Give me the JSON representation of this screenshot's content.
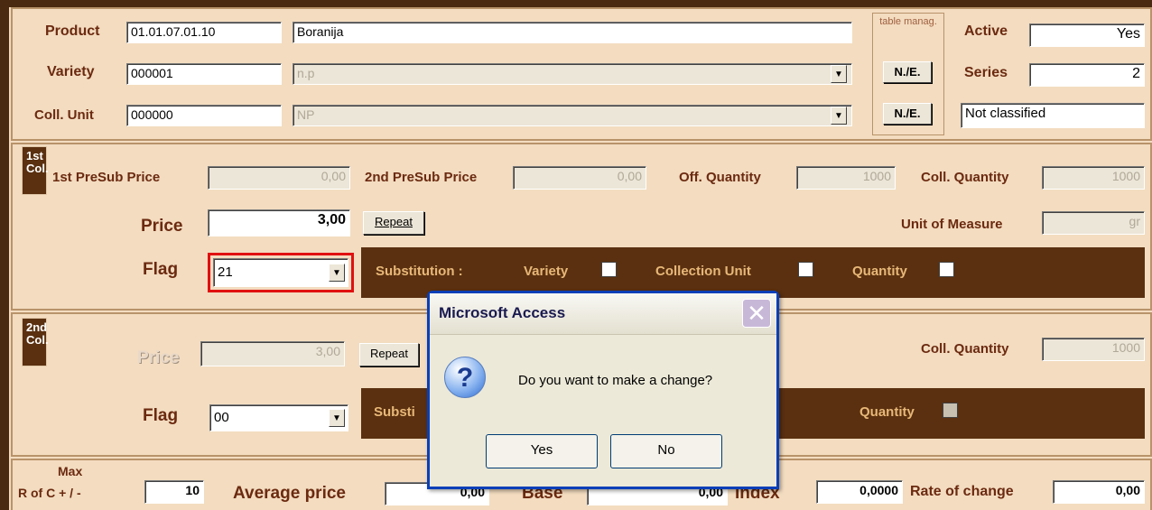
{
  "header": {
    "product_label": "Product",
    "product_code": "01.01.07.01.10",
    "product_name": "Boranija",
    "variety_label": "Variety",
    "variety_code": "000001",
    "variety_name": "n.p",
    "coll_unit_label": "Coll. Unit",
    "coll_unit_code": "000000",
    "coll_unit_name": "NP",
    "table_manag_label": "table manag.",
    "ne_button": "N./E.",
    "active_label": "Active",
    "active_value": "Yes",
    "series_label": "Series",
    "series_value": "2",
    "classification": "Not classified"
  },
  "col1": {
    "badge": "1st Col.",
    "presub1_label": "1st PreSub Price",
    "presub1_value": "0,00",
    "presub2_label": "2nd PreSub Price",
    "presub2_value": "0,00",
    "off_qty_label": "Off. Quantity",
    "off_qty_value": "1000",
    "coll_qty_label": "Coll. Quantity",
    "coll_qty_value": "1000",
    "price_label": "Price",
    "price_value": "3,00",
    "repeat_label": "Repeat",
    "uom_label": "Unit of Measure",
    "uom_value": "gr",
    "flag_label": "Flag",
    "flag_value": "21",
    "substitution_label": "Substitution :",
    "variety_chk_label": "Variety",
    "coll_unit_chk_label": "Collection Unit",
    "quantity_chk_label": "Quantity"
  },
  "col2": {
    "badge": "2nd Col.",
    "price_label": "Price",
    "price_value": "3,00",
    "repeat_label": "Repeat",
    "coll_qty_label": "Coll. Quantity",
    "coll_qty_value": "1000",
    "flag_label": "Flag",
    "flag_value": "00",
    "substitution_partial": "Substi",
    "quantity_chk_label": "Quantity"
  },
  "bottom": {
    "max_label": "Max",
    "rofc_label": "R of C + / -",
    "max_value": "10",
    "avg_label": "Average price",
    "avg_value": "0,00",
    "base_label": "Base",
    "base_value": "0,00",
    "index_label": "Index",
    "index_value": "0,0000",
    "rate_label": "Rate of change",
    "rate_value": "0,00"
  },
  "dialog": {
    "title": "Microsoft Access",
    "message": "Do you want to make a change?",
    "yes": "Yes",
    "no": "No",
    "icon": "question-icon"
  },
  "colors": {
    "dialog_border": "#0a3fb8",
    "flag_highlight": "#e01010",
    "label_text": "#6b2a10",
    "panel_bg": "#f3dcc0"
  }
}
